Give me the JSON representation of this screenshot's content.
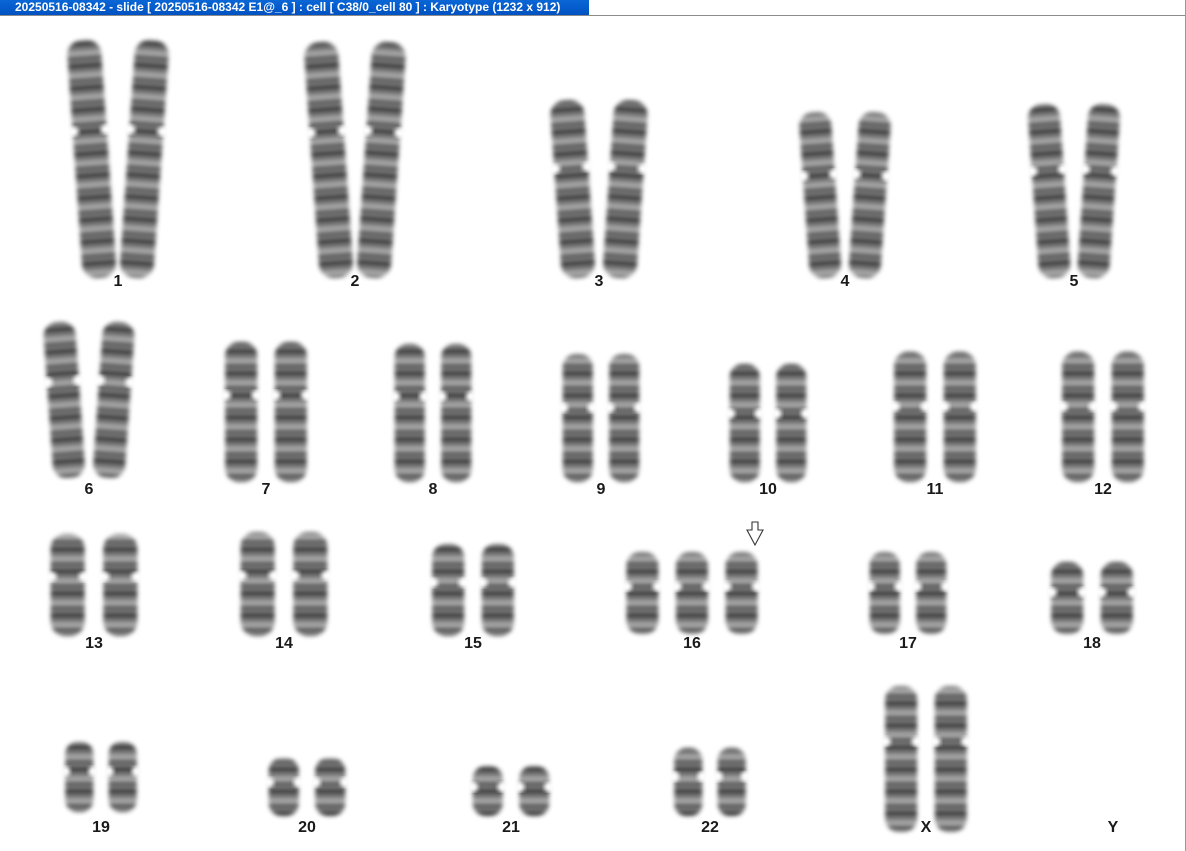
{
  "window": {
    "title": "20250516-08342 - slide [ 20250516-08342 E1@_6 ] : cell [ C38/0_cell 80 ] : Karyotype  (1232 x 912)"
  },
  "karyotype": {
    "groups": [
      {
        "label": "1",
        "count": 2
      },
      {
        "label": "2",
        "count": 2
      },
      {
        "label": "3",
        "count": 2
      },
      {
        "label": "4",
        "count": 2
      },
      {
        "label": "5",
        "count": 2
      },
      {
        "label": "6",
        "count": 2
      },
      {
        "label": "7",
        "count": 2
      },
      {
        "label": "8",
        "count": 2
      },
      {
        "label": "9",
        "count": 2
      },
      {
        "label": "10",
        "count": 2
      },
      {
        "label": "11",
        "count": 2
      },
      {
        "label": "12",
        "count": 2
      },
      {
        "label": "13",
        "count": 2
      },
      {
        "label": "14",
        "count": 2
      },
      {
        "label": "15",
        "count": 2
      },
      {
        "label": "16",
        "count": 3,
        "marked": true
      },
      {
        "label": "17",
        "count": 2
      },
      {
        "label": "18",
        "count": 2
      },
      {
        "label": "19",
        "count": 2
      },
      {
        "label": "20",
        "count": 2
      },
      {
        "label": "21",
        "count": 2
      },
      {
        "label": "22",
        "count": 2
      },
      {
        "label": "X",
        "count": 2
      },
      {
        "label": "Y",
        "count": 0
      }
    ]
  },
  "colors": {
    "titlebar": "#0a5fcf",
    "chromosome": "#3a3a3a"
  }
}
